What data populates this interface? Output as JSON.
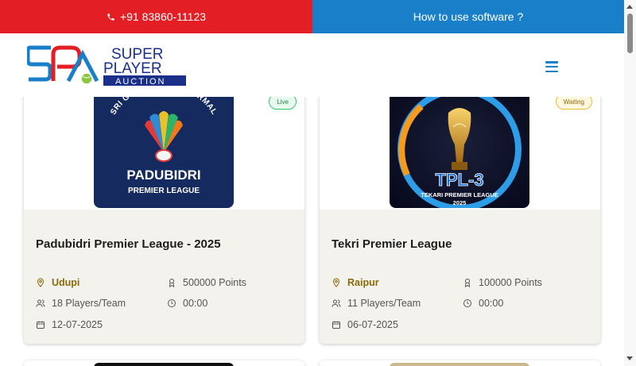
{
  "topbar": {
    "phone": "+91 83860-11123",
    "help_link": "How to use software ?"
  },
  "header": {
    "logo": {
      "line1": "SUPER",
      "line2": "PLAYER",
      "line3": "AUCTION",
      "monogram": "SPA"
    },
    "menu_icon": "hamburger-menu-icon"
  },
  "colors": {
    "red_bar": "#e31e24",
    "blue_bar": "#1a7fc9",
    "live": "#3cc26d",
    "waiting": "#e9bd3a",
    "city": "#8a6a0a"
  },
  "tournaments": [
    {
      "status": "Live",
      "name": "Padubidri Premier League - 2025",
      "city": "Udupi",
      "points": "500000 Points",
      "players_per_team": "18 Players/Team",
      "time": "00:00",
      "date": "12-07-2025",
      "poster": {
        "arc_text": "SRI GURU TROPHY YERMAL",
        "line1": "PADUBIDRI",
        "line2": "PREMIER LEAGUE"
      }
    },
    {
      "status": "Waiting",
      "name": "Tekri Premier League",
      "city": "Raipur",
      "points": "100000 Points",
      "players_per_team": "11 Players/Team",
      "time": "00:00",
      "date": "06-07-2025",
      "poster": {
        "line1": "TPL-3",
        "line2": "TEKARI PREMIER LEAGUE",
        "line3": "2025"
      }
    }
  ]
}
